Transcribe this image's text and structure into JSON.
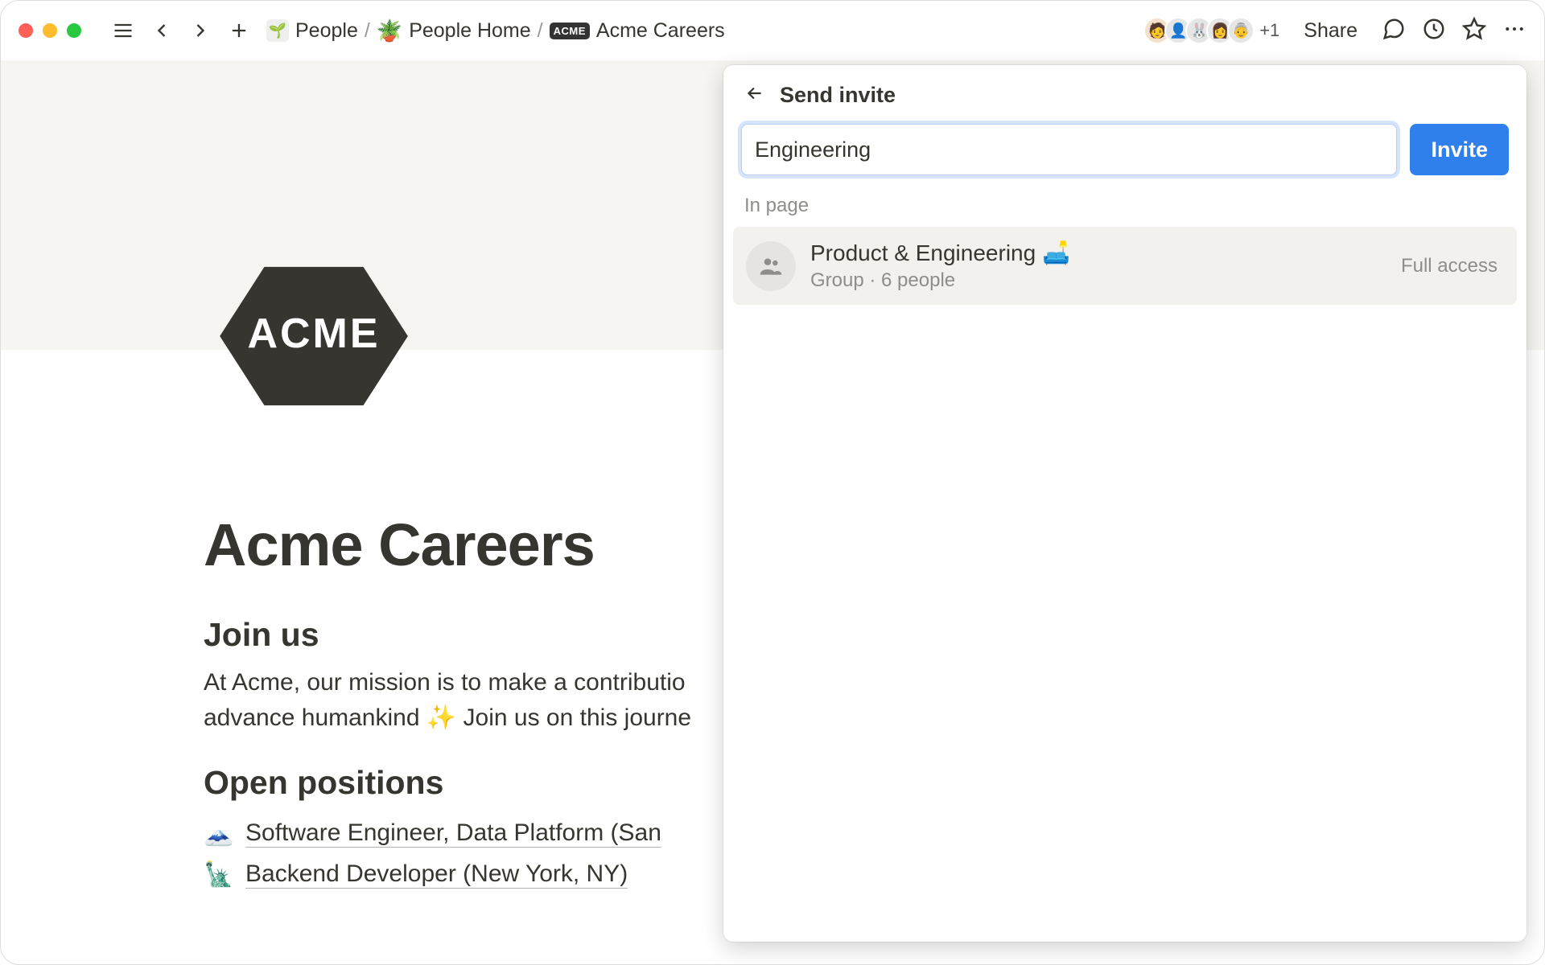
{
  "breadcrumb": {
    "item1_label": "People",
    "item2_emoji": "🪴",
    "item2_label": "People Home",
    "item3_badge": "ACME",
    "item3_label": "Acme Careers"
  },
  "toolbar": {
    "share_label": "Share",
    "avatar_overflow": "+1"
  },
  "page": {
    "logo_text": "ACME",
    "title": "Acme Careers",
    "joinus_heading": "Join us",
    "mission_line1": "At Acme, our mission is to make a contributio",
    "mission_line2": "advance humankind ✨ Join us on this journe",
    "open_positions_heading": "Open positions",
    "positions": [
      {
        "emoji": "🗻",
        "title": "Software Engineer, Data Platform (San "
      },
      {
        "emoji": "🗽",
        "title": "Backend Developer (New York, NY)"
      }
    ]
  },
  "invite": {
    "dialog_title": "Send invite",
    "input_value": "Engineering",
    "invite_button": "Invite",
    "section_label": "In page",
    "result": {
      "title": "Product & Engineering 🛋️",
      "subtitle": "Group · 6 people",
      "access": "Full access"
    }
  }
}
